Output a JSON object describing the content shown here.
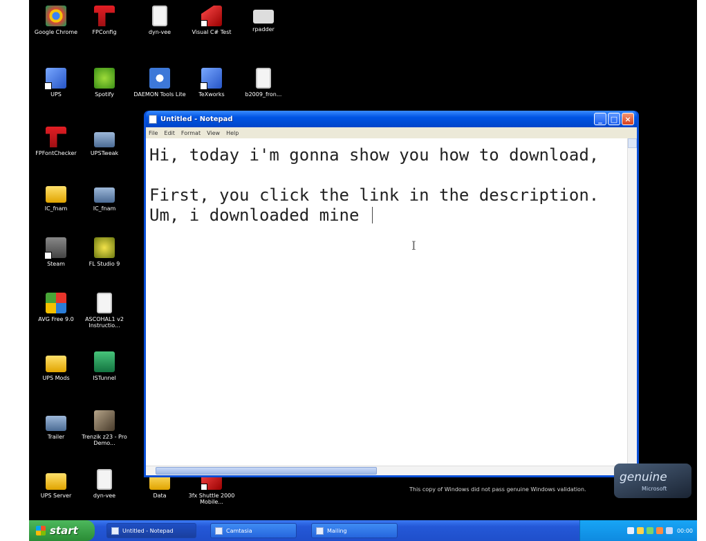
{
  "desktop": {
    "icons": [
      {
        "label": "Google Chrome",
        "icon": "chrome-icon"
      },
      {
        "label": "FPConfig",
        "icon": "fp-icon"
      },
      {
        "label": "dyn-vee",
        "icon": "document-icon"
      },
      {
        "label": "Visual C# Test",
        "icon": "shortcut-icon"
      },
      {
        "label": "rpadder",
        "icon": "gamepad-icon"
      },
      {
        "label": "UPS",
        "icon": "app-icon"
      },
      {
        "label": "Spotify",
        "icon": "spotify-icon"
      },
      {
        "label": "DAEMON Tools Lite",
        "icon": "daemon-tools-icon"
      },
      {
        "label": "TeXworks",
        "icon": "app-icon"
      },
      {
        "label": "b2009_fron...",
        "icon": "document-icon"
      },
      {
        "label": "FPFontChecker",
        "icon": "fp-icon"
      },
      {
        "label": "UPSTweak",
        "icon": "monitor-icon"
      },
      {
        "label": "IC_fnam",
        "icon": "folder-icon"
      },
      {
        "label": "IC_fnam",
        "icon": "monitor-icon"
      },
      {
        "label": "Steam",
        "icon": "steam-icon"
      },
      {
        "label": "FL Studio 9",
        "icon": "fl-studio-icon"
      },
      {
        "label": "AVG Free 9.0",
        "icon": "avg-icon"
      },
      {
        "label": "ASCOHAL1 v2 Instructio...",
        "icon": "document-icon"
      },
      {
        "label": "UPS Mods",
        "icon": "folder-icon"
      },
      {
        "label": "ISTunnel",
        "icon": "recycle-icon"
      },
      {
        "label": "Trailer",
        "icon": "monitor-icon"
      },
      {
        "label": "Trenzik z23 - Pro Demo...",
        "icon": "photo-icon"
      },
      {
        "label": "UPS Server",
        "icon": "folder-icon"
      },
      {
        "label": "dyn-vee",
        "icon": "document-icon"
      },
      {
        "label": "Data",
        "icon": "folder-icon"
      },
      {
        "label": "3fx Shuttle 2000 Mobile...",
        "icon": "shortcut-icon"
      }
    ]
  },
  "notepad": {
    "title": "Untitled - Notepad",
    "menu": [
      "File",
      "Edit",
      "Format",
      "View",
      "Help"
    ],
    "text_lines": [
      "Hi, today i'm gonna show you how to download,",
      "",
      "First, you click the link in the description.",
      "Um, i downloaded mine "
    ],
    "minimize_label": "_",
    "maximize_label": "□",
    "close_label": "×"
  },
  "watermark": {
    "text": "This copy of Windows did not pass genuine Windows validation.",
    "badge_big": "genuine",
    "badge_small": "Microsoft"
  },
  "taskbar": {
    "start_label": "start",
    "tasks": [
      {
        "label": "Untitled - Notepad",
        "active": true
      },
      {
        "label": "Camtasia",
        "active": false
      },
      {
        "label": "Mailing",
        "active": false
      }
    ],
    "clock": "00:00"
  }
}
